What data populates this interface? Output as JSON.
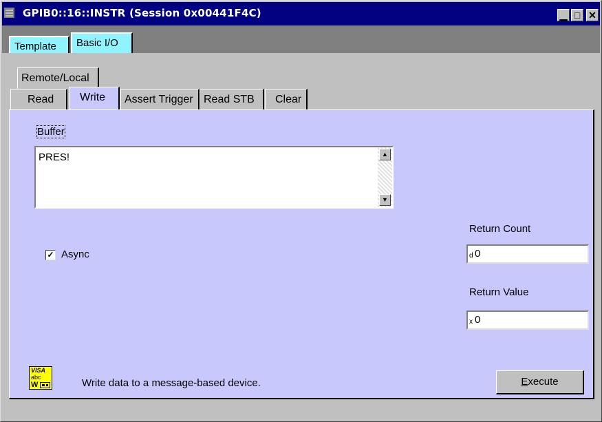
{
  "window": {
    "title": "GPIB0::16::INSTR (Session 0x00441F4C)",
    "controls": {
      "minimize": "▁",
      "maximize": "□",
      "close": "✕"
    }
  },
  "top_tabs": [
    {
      "label": "Template"
    },
    {
      "label": "Basic I/O",
      "active": true
    }
  ],
  "sub_tabs_row1": [
    {
      "label": "Remote/Local"
    }
  ],
  "sub_tabs_row2": [
    {
      "label": "Read"
    },
    {
      "label": "Write",
      "active": true
    },
    {
      "label": "Assert Trigger"
    },
    {
      "label": "Read STB"
    },
    {
      "label": "Clear"
    }
  ],
  "write_panel": {
    "buffer_label": "Buffer",
    "buffer_value": "PRES!",
    "async_label": "Async",
    "async_checked": true,
    "return_count_label": "Return Count",
    "return_count_radix": "d",
    "return_count_value": "0",
    "return_value_label": "Return Value",
    "return_value_radix": "x",
    "return_value_value": "0",
    "description": "Write data to a message-based device.",
    "execute_label_first": "E",
    "execute_label_rest": "xecute",
    "visa_icon": {
      "line1": "VISA",
      "line2": "abc",
      "line3": "W"
    }
  },
  "colors": {
    "title_bar": "#000080",
    "panel_bg": "#c9c8fd",
    "active_tab": "#8ff4ff"
  }
}
